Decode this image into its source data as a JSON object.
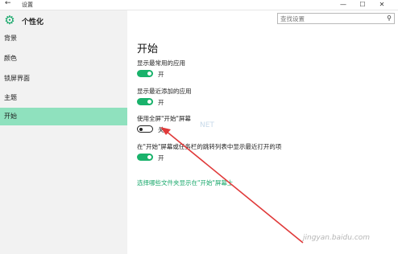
{
  "window": {
    "back_glyph": "←",
    "title": "设置",
    "min_glyph": "—",
    "max_glyph": "☐",
    "close_glyph": "✕"
  },
  "sidebar": {
    "icon": "gear-icon",
    "header": "个性化",
    "items": [
      {
        "label": "背景"
      },
      {
        "label": "颜色"
      },
      {
        "label": "锁屏界面"
      },
      {
        "label": "主题"
      },
      {
        "label": "开始",
        "active": true
      }
    ]
  },
  "search": {
    "placeholder": "查找设置",
    "icon": "search-icon"
  },
  "main": {
    "heading": "开始",
    "settings": [
      {
        "label": "显示最常用的应用",
        "state": "开",
        "on": true
      },
      {
        "label": "显示最近添加的应用",
        "state": "开",
        "on": true
      },
      {
        "label": "使用全屏\"开始\"屏幕",
        "state": "关",
        "on": false
      },
      {
        "label": "在\"开始\"屏幕或任务栏的跳转列表中显示最近打开的项",
        "state": "开",
        "on": true
      }
    ],
    "link": "选择哪些文件夹显示在\"开始\"屏幕上"
  },
  "watermark": {
    "overlay": "NET",
    "site": "jingyan.baidu.com"
  },
  "colors": {
    "accent": "#19b26b",
    "selected_bg": "#8fe1be",
    "arrow": "#e03a3a"
  }
}
